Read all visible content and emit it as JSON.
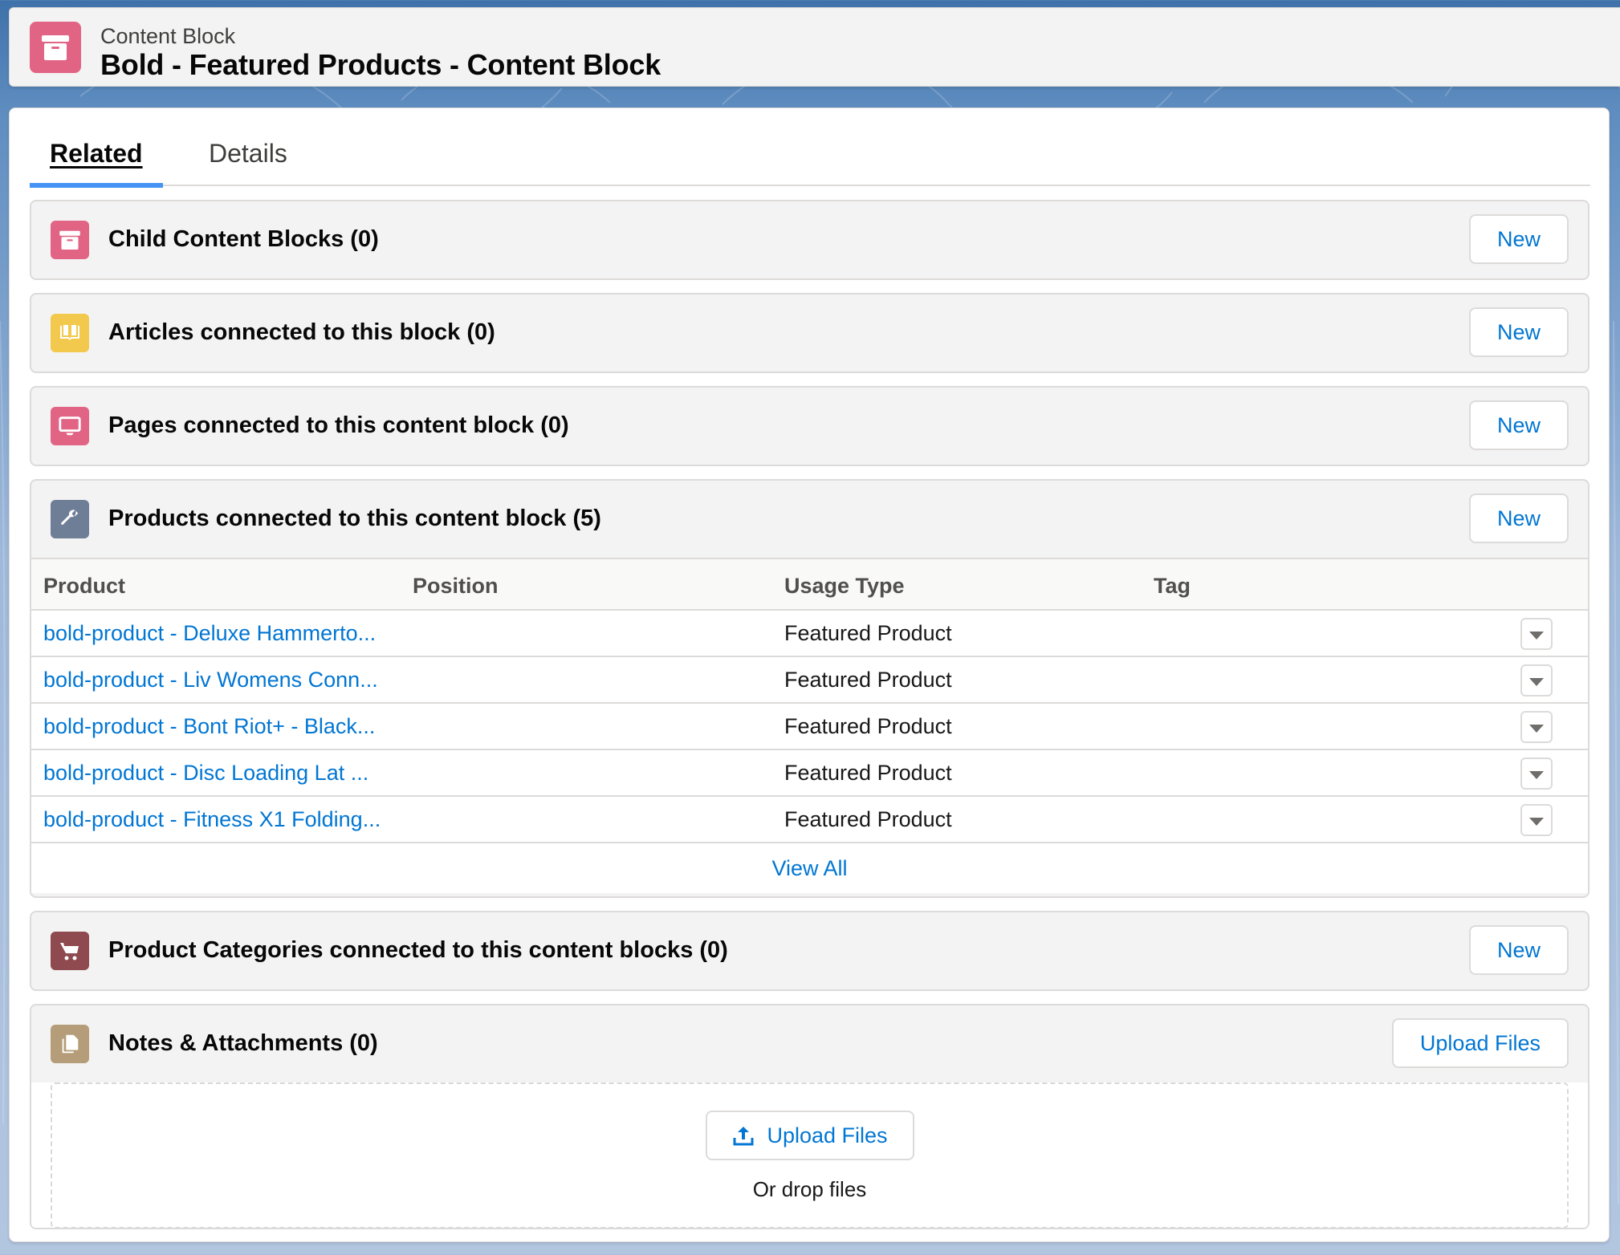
{
  "header": {
    "object_type": "Content Block",
    "title": "Bold - Featured Products - Content Block",
    "icon": "archive-box-icon",
    "icon_color": "#e26485"
  },
  "tabs": [
    {
      "label": "Related",
      "active": true
    },
    {
      "label": "Details",
      "active": false
    }
  ],
  "sections": [
    {
      "title": "Child Content Blocks (0)",
      "icon": "archive-box-icon",
      "icon_color": "#e26485",
      "action": "New"
    },
    {
      "title": "Articles connected to this block (0)",
      "icon": "open-book-icon",
      "icon_color": "#f2c94c",
      "action": "New"
    },
    {
      "title": "Pages connected to this content block (0)",
      "icon": "monitor-icon",
      "icon_color": "#e26485",
      "action": "New"
    },
    {
      "title": "Products connected to this content block (5)",
      "icon": "wrench-icon",
      "icon_color": "#6f7e97",
      "action": "New"
    },
    {
      "title": "Product Categories connected to this content blocks (0)",
      "icon": "cart-icon",
      "icon_color": "#8e4a4f",
      "action": "New"
    },
    {
      "title": "Notes & Attachments (0)",
      "icon": "files-icon",
      "icon_color": "#b49d78",
      "action": "Upload Files"
    }
  ],
  "products_table": {
    "columns": [
      "Product",
      "Position",
      "Usage Type",
      "Tag"
    ],
    "rows": [
      {
        "product": "bold-product - Deluxe Hammerto...",
        "position": "",
        "usage_type": "Featured Product",
        "tag": ""
      },
      {
        "product": "bold-product - Liv Womens Conn...",
        "position": "",
        "usage_type": "Featured Product",
        "tag": ""
      },
      {
        "product": "bold-product - Bont Riot+ - Black...",
        "position": "",
        "usage_type": "Featured Product",
        "tag": ""
      },
      {
        "product": "bold-product - Disc Loading Lat ...",
        "position": "",
        "usage_type": "Featured Product",
        "tag": ""
      },
      {
        "product": "bold-product - Fitness X1 Folding...",
        "position": "",
        "usage_type": "Featured Product",
        "tag": ""
      }
    ],
    "view_all": "View All"
  },
  "attachments": {
    "upload_button": "Upload Files",
    "drop_text": "Or drop files"
  },
  "colors": {
    "link": "#0176d3",
    "tab_active_indicator": "#4593f5"
  }
}
